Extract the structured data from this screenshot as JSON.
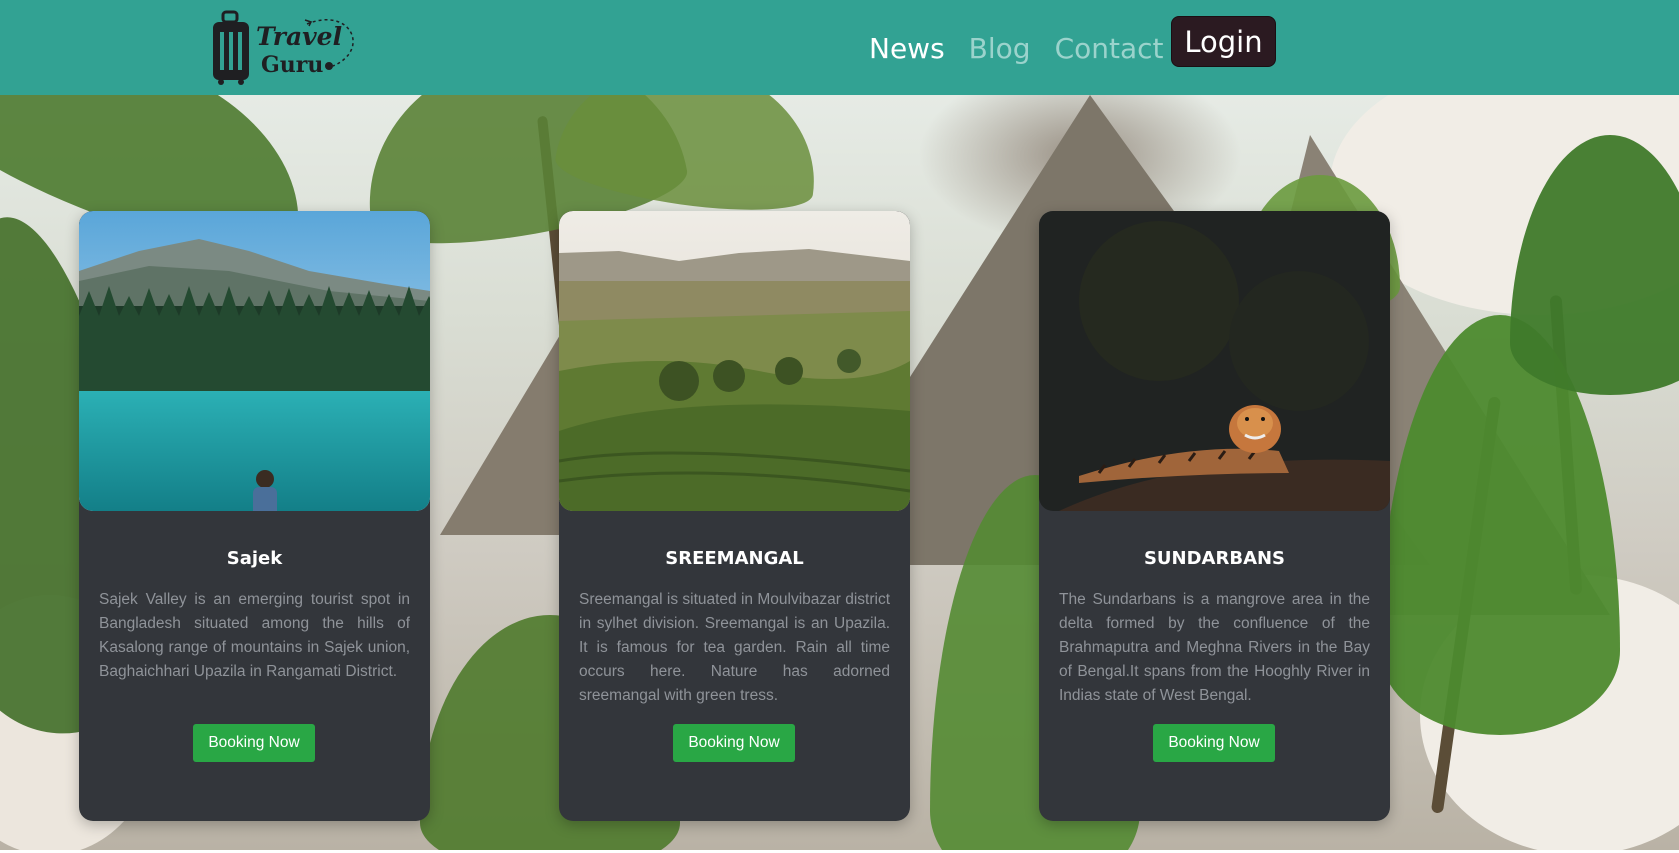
{
  "nav": {
    "logo_line1": "Travel",
    "logo_line2": "Guru",
    "links": [
      "News",
      "Blog",
      "Contact"
    ],
    "login_label": "Login"
  },
  "cards": [
    {
      "title": "Sajek",
      "description": "Sajek Valley is an emerging tourist spot in Bangladesh situated among the hills of Kasalong range of mountains in Sajek union, Baghaichhari Upazila in Rangamati District.",
      "button": "Booking Now"
    },
    {
      "title": "SREEMANGAL",
      "description": "Sreemangal is situated in Moulvibazar district in sylhet division. Sreemangal is an Upazila. It is famous for tea garden. Rain all time occurs here. Nature has adorned sreemangal with green tress.",
      "button": "Booking Now"
    },
    {
      "title": "SUNDARBANS",
      "description": "The Sundarbans is a mangrove area in the delta formed by the confluence of the Brahmaputra and Meghna Rivers in the Bay of Bengal.It spans from the Hooghly River in Indias state of West Bengal.",
      "button": "Booking Now"
    }
  ],
  "colors": {
    "navbar": "#32a293",
    "card_bg": "#33363b",
    "button_green": "#29a745",
    "login_bg": "#2b1a21"
  }
}
